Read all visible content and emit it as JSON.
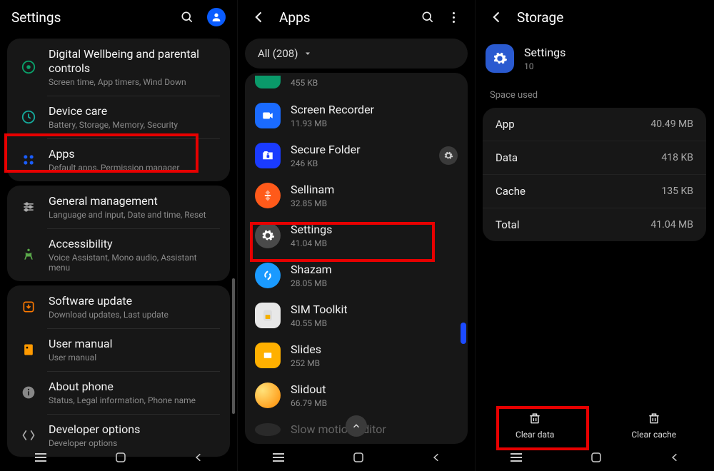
{
  "p1": {
    "header": {
      "title": "Settings"
    },
    "groups": [
      {
        "items": [
          {
            "title": "Digital Wellbeing and parental controls",
            "sub": "Screen time, App timers, Wind Down",
            "icon": "wellbeing",
            "color": "#0aa06a"
          },
          {
            "title": "Device care",
            "sub": "Battery, Storage, Memory, Security",
            "icon": "devicecare",
            "color": "#15a89a"
          },
          {
            "title": "Apps",
            "sub": "Default apps, Permission manager",
            "icon": "apps",
            "color": "#1a5dff"
          }
        ]
      },
      {
        "items": [
          {
            "title": "General management",
            "sub": "Language and input, Date and time, Reset",
            "icon": "sliders",
            "color": "#888"
          },
          {
            "title": "Accessibility",
            "sub": "Voice Assistant, Mono audio, Assistant menu",
            "icon": "a11y",
            "color": "#5aa84a"
          }
        ]
      },
      {
        "items": [
          {
            "title": "Software update",
            "sub": "Download updates, Last update",
            "icon": "update",
            "color": "#ff7a00"
          },
          {
            "title": "User manual",
            "sub": "User manual",
            "icon": "manual",
            "color": "#ff9a00"
          },
          {
            "title": "About phone",
            "sub": "Status, Legal information, Phone name",
            "icon": "info",
            "color": "#888"
          },
          {
            "title": "Developer options",
            "sub": "Developer options",
            "icon": "dev",
            "color": "#888"
          }
        ]
      }
    ]
  },
  "p2": {
    "header": {
      "title": "Apps"
    },
    "filter": "All (208)",
    "apps": [
      {
        "title": "",
        "sub": "455 KB",
        "bg": "#0a9a6a",
        "partial": true
      },
      {
        "title": "Screen Recorder",
        "sub": "11.93 MB",
        "bg": "#1a6bff"
      },
      {
        "title": "Secure Folder",
        "sub": "246 KB",
        "bg": "#1a3bff",
        "gear": true
      },
      {
        "title": "Sellinam",
        "sub": "32.85 MB",
        "bg": "#ff5a1a"
      },
      {
        "title": "Settings",
        "sub": "41.04 MB",
        "bg": "#4a4a4a",
        "settings": true
      },
      {
        "title": "Shazam",
        "sub": "28.05 MB",
        "bg": "#1a9aff"
      },
      {
        "title": "SIM Toolkit",
        "sub": "40.55 MB",
        "bg": "#e8e8e8"
      },
      {
        "title": "Slides",
        "sub": "252 MB",
        "bg": "#ffb000"
      },
      {
        "title": "Slidout",
        "sub": "66.79 MB",
        "bg": "#ffb84a"
      },
      {
        "title": "Slow motion editor",
        "sub": "",
        "bg": "#333",
        "partial_bottom": true
      }
    ]
  },
  "p3": {
    "header": {
      "title": "Storage"
    },
    "app": {
      "name": "Settings",
      "meta": "10"
    },
    "section": "Space used",
    "rows": [
      {
        "k": "App",
        "v": "40.49 MB"
      },
      {
        "k": "Data",
        "v": "418 KB"
      },
      {
        "k": "Cache",
        "v": "135 KB"
      },
      {
        "k": "Total",
        "v": "41.04 MB"
      }
    ],
    "actions": {
      "clear_data": "Clear data",
      "clear_cache": "Clear cache"
    }
  }
}
